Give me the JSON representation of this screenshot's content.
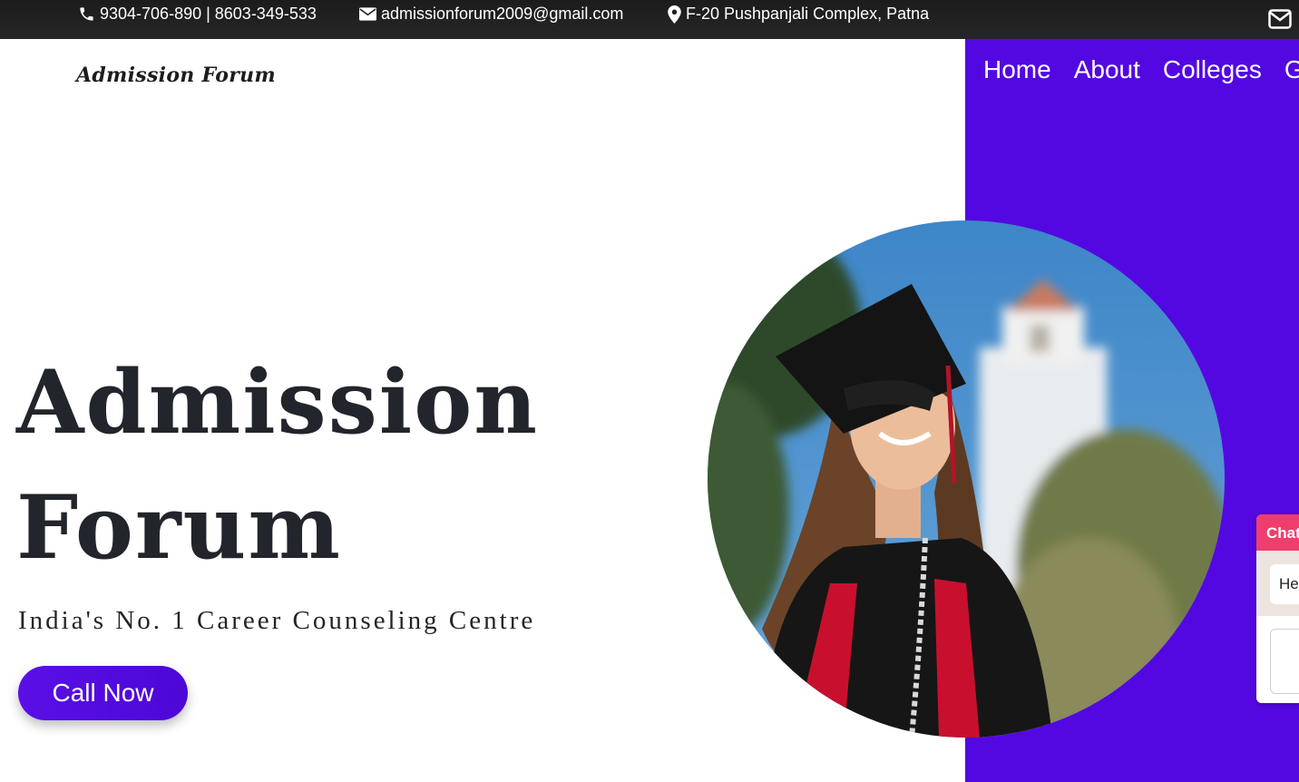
{
  "topbar": {
    "phone": "9304-706-890 | 8603-349-533",
    "email": "admissionforum2009@gmail.com",
    "address": "F-20 Pushpanjali Complex, Patna",
    "icons": [
      "phone-icon",
      "envelope-icon",
      "map-pin-icon",
      "mail-icon"
    ]
  },
  "brand": {
    "logo_text": "Admission Forum"
  },
  "nav": {
    "items": [
      {
        "label": "Home"
      },
      {
        "label": "About"
      },
      {
        "label": "Colleges"
      },
      {
        "label": "G"
      }
    ]
  },
  "hero": {
    "title_line1": "Admission",
    "title_line2": "Forum",
    "subtitle": "India's No. 1 Career Counseling Centre",
    "cta_label": "Call Now"
  },
  "chat": {
    "header": "Chat",
    "message": "He"
  },
  "colors": {
    "accent": "#5308e1",
    "chat_header": "#ef3e6d",
    "topbar": "#1f1f1f",
    "heading": "#22252b"
  }
}
